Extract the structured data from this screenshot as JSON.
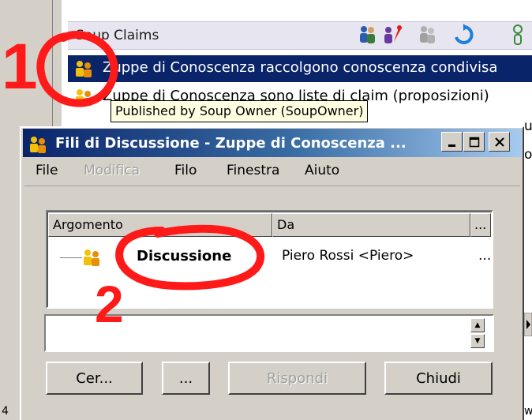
{
  "background_window": {
    "panel_title": "Soup Claims",
    "claims": [
      "Zuppe di Conoscenza raccolgono conoscenza condivisa",
      "Zuppe di Conoscenza sono liste di claim (proposizioni)"
    ],
    "tooltip": "Published by Soup Owner (SoupOwner)",
    "fragments": [
      "u",
      "o",
      "4",
      "w"
    ]
  },
  "annotations": {
    "step1": "1",
    "step2": "2",
    "color": "#ff1a1a"
  },
  "dialog": {
    "title": "Fili di Discussione - Zuppe di Conoscenza ...",
    "menu": [
      "File",
      "Modifica",
      "Filo",
      "Finestra",
      "Aiuto"
    ],
    "menu_disabled": [
      "Modifica"
    ],
    "columns": [
      "Argomento",
      "Da",
      "..."
    ],
    "thread": {
      "argomento": "Discussione",
      "da": "Piero Rossi <Piero>",
      "extra": "..."
    },
    "buttons": {
      "search": "Cer...",
      "more": "...",
      "reply": "Rispondi",
      "close": "Chiudi"
    }
  },
  "colors": {
    "titlebar_start": "#0a246a",
    "titlebar_end": "#a6caf0",
    "selection": "#0a246a",
    "face": "#d4d0c8",
    "tooltip_bg": "#ffffe1"
  },
  "icons": [
    "people-icon",
    "person-pin-icon",
    "group-icon",
    "refresh-icon",
    "user-icon",
    "claim-icon",
    "discussion-icon",
    "minimize-icon",
    "maximize-icon",
    "close-icon"
  ]
}
